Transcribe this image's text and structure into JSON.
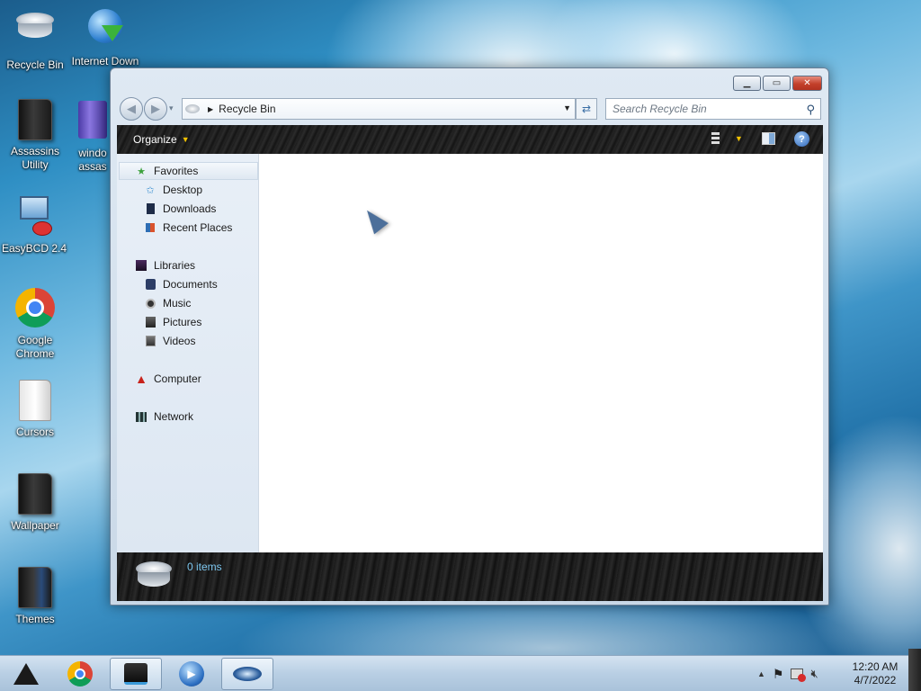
{
  "desktop": {
    "icons": [
      {
        "label": "Recycle Bin",
        "icon": "recycle-bin-icon"
      },
      {
        "label": "Internet Down",
        "icon": "internet-download-manager-icon"
      },
      {
        "label": "Assassins Utility",
        "icon": "folder-icon"
      },
      {
        "label": "windo assas",
        "icon": "winrar-archive-icon"
      },
      {
        "label": "EasyBCD 2.4",
        "icon": "easybcd-icon"
      },
      {
        "label": "Google Chrome",
        "icon": "chrome-icon"
      },
      {
        "label": "Cursors",
        "icon": "folder-icon"
      },
      {
        "label": "Wallpaper",
        "icon": "folder-icon"
      },
      {
        "label": "Themes",
        "icon": "folder-icon"
      }
    ]
  },
  "window": {
    "title": "Recycle Bin",
    "caption": {
      "minimize": "minimize",
      "maximize": "maximize",
      "close": "close"
    },
    "address": {
      "location": "Recycle Bin"
    },
    "search": {
      "placeholder": "Search Recycle Bin"
    },
    "toolbar": {
      "organize": "Organize"
    },
    "nav_pane": {
      "favorites": {
        "label": "Favorites",
        "items": [
          "Desktop",
          "Downloads",
          "Recent Places"
        ]
      },
      "libraries": {
        "label": "Libraries",
        "items": [
          "Documents",
          "Music",
          "Pictures",
          "Videos"
        ]
      },
      "computer": "Computer",
      "network": "Network"
    },
    "status": {
      "items": "0 items"
    }
  },
  "taskbar": {
    "apps": [
      "start-icon",
      "chrome-icon",
      "explorer-icon",
      "media-player-icon",
      "recycle-bin-icon"
    ],
    "clock": {
      "time": "12:20 AM",
      "date": "4/7/2022"
    }
  },
  "colors": {
    "accent": "#3a6ea5",
    "toolbar_bg": "#1d1d1d",
    "status_text": "#7ec8f0",
    "organize_arrow": "#f2c200"
  }
}
